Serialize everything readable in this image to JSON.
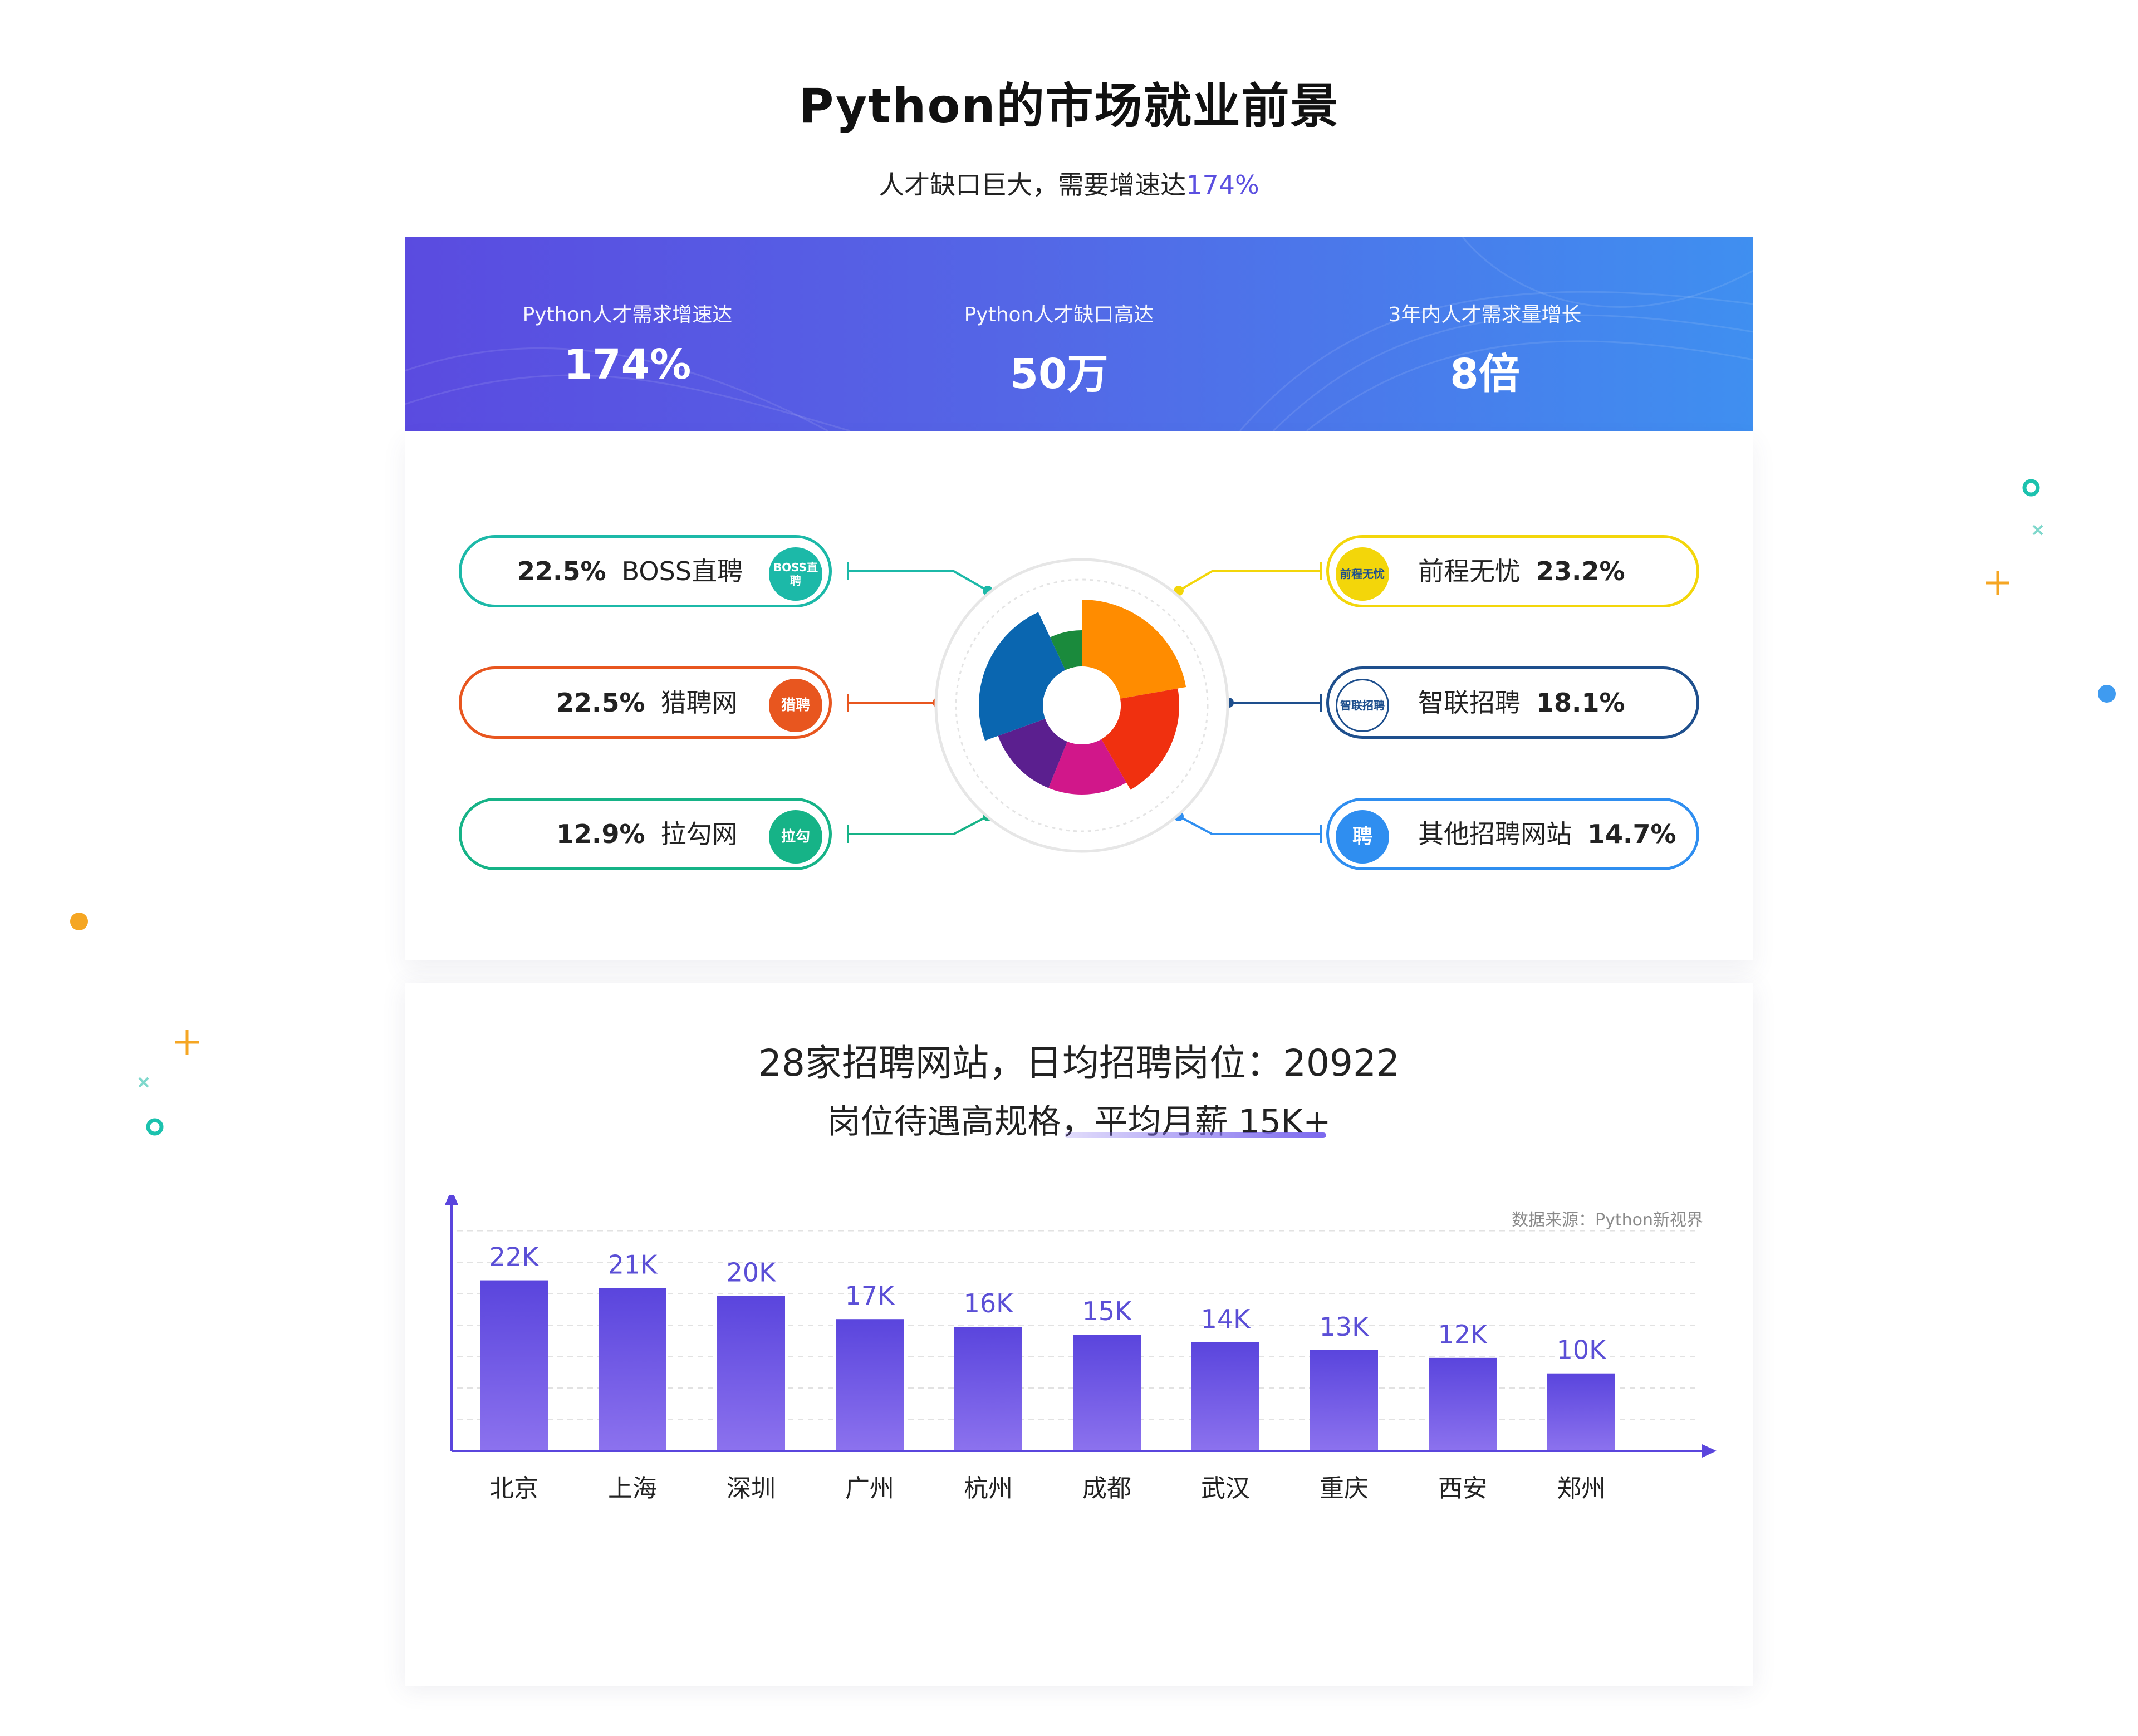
{
  "header": {
    "title": "Python的市场就业前景",
    "subtitle_prefix": "人才缺口巨大，需要增速达",
    "subtitle_highlight": "174%"
  },
  "stats": [
    {
      "label": "Python人才需求增速达",
      "value": "174%"
    },
    {
      "label": "Python人才缺口高达",
      "value": "50万"
    },
    {
      "label": "3年内人才需求量增长",
      "value": "8倍"
    }
  ],
  "platforms": {
    "left": [
      {
        "pct": "22.5%",
        "name": "BOSS直聘",
        "logo_text": "BOSS直聘",
        "color": "#1cb9a8",
        "icon": "boss-logo-icon"
      },
      {
        "pct": "22.5%",
        "name": "猎聘网",
        "logo_text": "猎聘",
        "color": "#e8561f",
        "icon": "liepin-logo-icon"
      },
      {
        "pct": "12.9%",
        "name": "拉勾网",
        "logo_text": "拉勾",
        "color": "#16b387",
        "icon": "lagou-logo-icon"
      }
    ],
    "right": [
      {
        "pct": "23.2%",
        "name": "前程无忧",
        "logo_text": "前程无忧",
        "color": "#f3d60a",
        "icon": "51job-logo-icon"
      },
      {
        "pct": "18.1%",
        "name": "智联招聘",
        "logo_text": "智联招聘",
        "color": "#1e4f8d",
        "icon": "zhaopin-logo-icon"
      },
      {
        "pct": "14.7%",
        "name": "其他招聘网站",
        "logo_text": "聘",
        "color": "#2f8ef0",
        "icon": "search-job-icon"
      }
    ]
  },
  "pie_colors": [
    "#ff8c00",
    "#f0300f",
    "#d1178a",
    "#5b1f8f",
    "#0a66b0",
    "#1a8a3c"
  ],
  "chart_data": {
    "type": "bar",
    "title": "28家招聘网站，日均招聘岗位：20922",
    "subtitle": "岗位待遇高规格，平均月薪 15K+",
    "source": "数据来源：Python新视界",
    "categories": [
      "北京",
      "上海",
      "深圳",
      "广州",
      "杭州",
      "成都",
      "武汉",
      "重庆",
      "西安",
      "郑州"
    ],
    "values": [
      22,
      21,
      20,
      17,
      16,
      15,
      14,
      13,
      12,
      10
    ],
    "labels": [
      "22K",
      "21K",
      "20K",
      "17K",
      "16K",
      "15K",
      "14K",
      "13K",
      "12K",
      "10K"
    ],
    "ylim": [
      0,
      28
    ],
    "grid": true,
    "bar_color_top": "#5a45dd",
    "bar_color_bottom": "#8c72ee",
    "axis_color": "#5a45dd",
    "label_color": "#5b4fd6"
  }
}
